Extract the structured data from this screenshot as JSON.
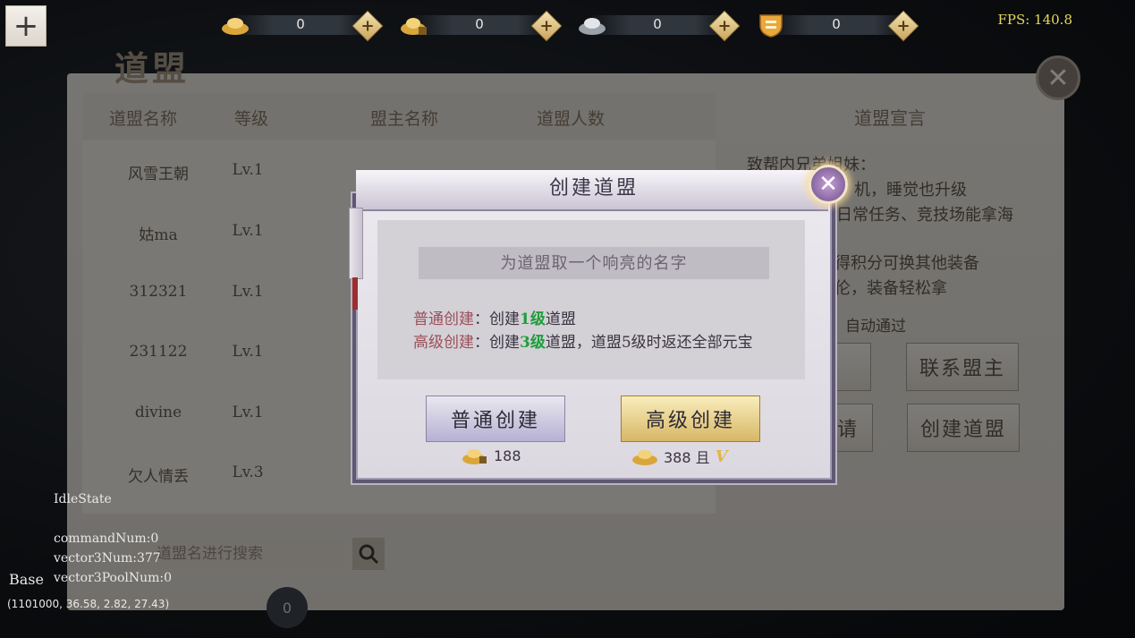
{
  "topbar": {
    "currencies": [
      {
        "icon": "gold-ingot-icon",
        "value": "0"
      },
      {
        "icon": "bound-gold-ingot-icon",
        "value": "0"
      },
      {
        "icon": "silver-ingot-icon",
        "value": "0"
      },
      {
        "icon": "shield-badge-icon",
        "value": "0"
      }
    ],
    "add_symbol": "+",
    "menu_symbol": "+",
    "fps": "FPS: 140.8"
  },
  "background": {
    "title": "道盟",
    "close_symbol": "✕",
    "columns": [
      "道盟名称",
      "等级",
      "盟主名称",
      "道盟人数"
    ],
    "rows": [
      {
        "name": "风雪王朝",
        "level": "Lv.1"
      },
      {
        "name": "姑ma",
        "level": "Lv.1"
      },
      {
        "name": "312321",
        "level": "Lv.1"
      },
      {
        "name": "231122",
        "level": "Lv.1"
      },
      {
        "name": "divine",
        "level": "Lv.1"
      },
      {
        "name": "欠人情丢",
        "level": "Lv.3"
      }
    ],
    "search_placeholder": "道盟名进行搜索",
    "bottom_count": "0",
    "declaration": {
      "title": "道盟宣言",
      "lines": [
        "致帮内兄弟姐妹：",
        "机，睡觉也升级",
        "日常任务、竞技场能拿海",
        "得积分可换其他装备",
        "伦，装备轻松拿"
      ],
      "auto_pass": "：自动通过"
    },
    "buttons": {
      "contact": "联系盟主",
      "create": "创建道盟",
      "apply_partial": "请"
    }
  },
  "debug": {
    "state": "IdleState",
    "command": "commandNum:0",
    "vector3": "vector3Num:377",
    "pool": "vector3PoolNum:0",
    "base": "Base",
    "coords": "(1101000, 36.58, 2.82, 27.43)"
  },
  "modal": {
    "title": "创建道盟",
    "close_symbol": "✕",
    "name_placeholder": "为道盟取一个响亮的名字",
    "normal": {
      "label": "普通创建",
      "sep": "：创建",
      "level": "1级",
      "rest": "道盟"
    },
    "advanced": {
      "label": "高级创建",
      "sep": "：创建",
      "level": "3级",
      "rest": "道盟，道盟5级时返还全部元宝"
    },
    "normal_button": "普通创建",
    "advanced_button": "高级创建",
    "normal_cost": "188",
    "advanced_cost": "388 且",
    "vip_mark": "V"
  },
  "colors": {
    "label_red": "#9c4f5a",
    "level_green": "#1f9e3c",
    "gold": "#d8b766",
    "lavender": "#b7b1d3"
  }
}
